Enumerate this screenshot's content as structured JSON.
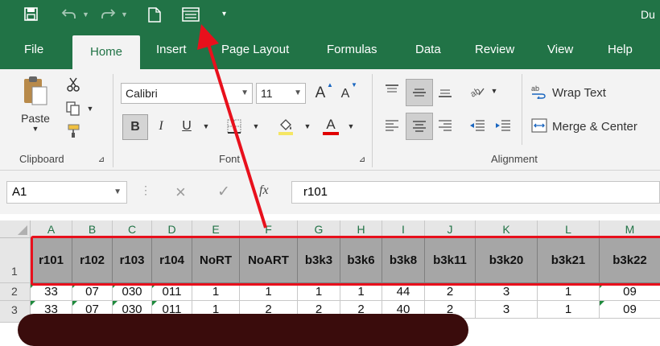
{
  "window": {
    "title_fragment": "Du"
  },
  "quick_access": {
    "save": "save-icon",
    "undo": "undo-icon",
    "redo": "redo-icon",
    "new": "new-document-icon",
    "form": "form-icon",
    "customize": "customize-icon"
  },
  "tabs": [
    {
      "label": "File"
    },
    {
      "label": "Home"
    },
    {
      "label": "Insert"
    },
    {
      "label": "Page Layout"
    },
    {
      "label": "Formulas"
    },
    {
      "label": "Data"
    },
    {
      "label": "Review"
    },
    {
      "label": "View"
    },
    {
      "label": "Help"
    }
  ],
  "ribbon": {
    "clipboard": {
      "paste_label": "Paste",
      "group_label": "Clipboard"
    },
    "font": {
      "font_name": "Calibri",
      "font_size": "11",
      "bold": "B",
      "italic": "I",
      "underline": "U",
      "font_color_letter": "A",
      "grow": "A",
      "shrink": "A",
      "group_label": "Font"
    },
    "alignment": {
      "wrap_text": "Wrap Text",
      "merge_center": "Merge & Center",
      "group_label": "Alignment"
    }
  },
  "formula_bar": {
    "name_box": "A1",
    "cancel": "×",
    "enter": "✓",
    "fx": "fx",
    "value": "r101"
  },
  "columns": [
    "A",
    "B",
    "C",
    "D",
    "E",
    "F",
    "G",
    "H",
    "I",
    "J",
    "K",
    "L",
    "M"
  ],
  "rows": [
    {
      "num": "1",
      "cells": [
        "r101",
        "r102",
        "r103",
        "r104",
        "NoRT",
        "NoART",
        "b3k3",
        "b3k6",
        "b3k8",
        "b3k11",
        "b3k20",
        "b3k21",
        "b3k22"
      ]
    },
    {
      "num": "2",
      "cells": [
        "33",
        "07",
        "030",
        "011",
        "1",
        "1",
        "1",
        "1",
        "44",
        "2",
        "3",
        "1",
        "09"
      ]
    },
    {
      "num": "3",
      "cells": [
        "33",
        "07",
        "030",
        "011",
        "1",
        "2",
        "2",
        "2",
        "40",
        "2",
        "3",
        "1",
        "09"
      ]
    }
  ],
  "colors": {
    "accent": "#217346",
    "annotation": "#e8101c",
    "header_fill": "#a6a6a6"
  }
}
